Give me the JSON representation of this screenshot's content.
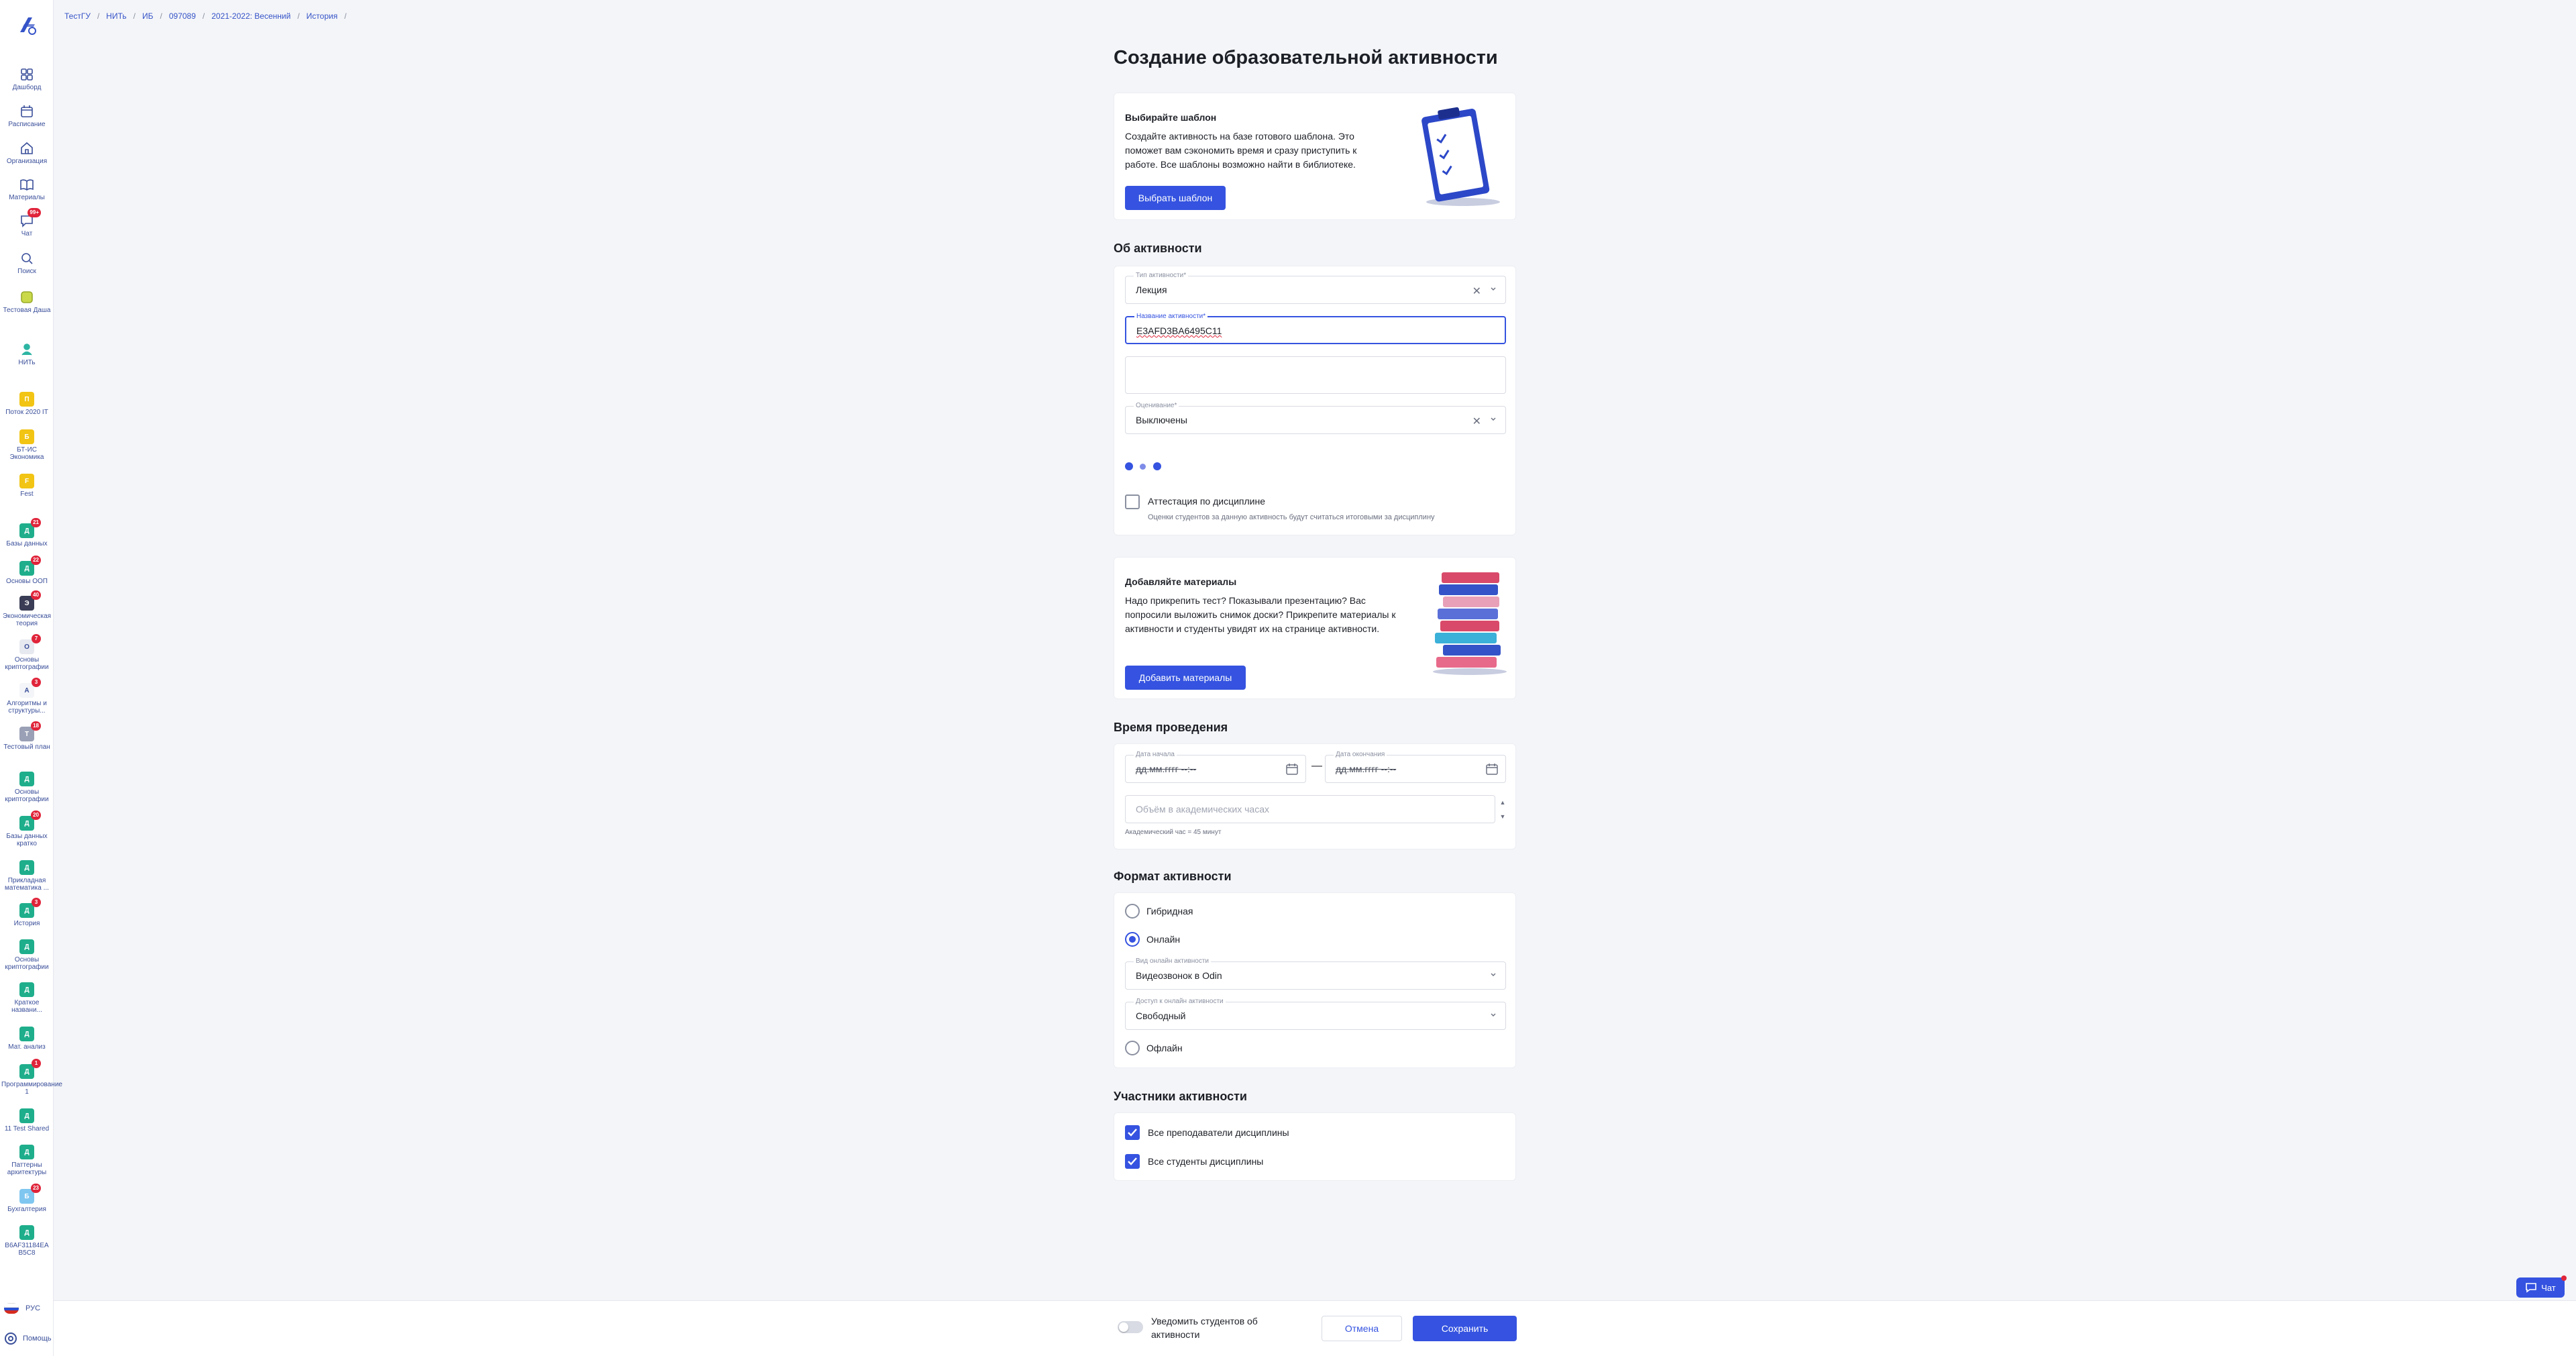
{
  "breadcrumb": [
    "ТестГУ",
    "НИТь",
    "ИБ",
    "097089",
    "2021-2022: Весенний",
    "История"
  ],
  "sidebar": {
    "nav": [
      {
        "label": "Дашборд",
        "icon": "dashboard-icon"
      },
      {
        "label": "Расписание",
        "icon": "calendar-icon"
      },
      {
        "label": "Организация",
        "icon": "home-icon"
      },
      {
        "label": "Материалы",
        "icon": "book-icon"
      },
      {
        "label": "Чат",
        "icon": "chat-icon",
        "badge": "99+"
      },
      {
        "label": "Поиск",
        "icon": "search-icon"
      },
      {
        "label": "Тестовая Даша",
        "icon": "test-icon"
      },
      {
        "label": "НИТь",
        "icon": "nit-icon"
      }
    ],
    "groups": [
      {
        "letter": "П",
        "label": "Поток 2020 IT",
        "color": "#f2c414"
      },
      {
        "letter": "Б",
        "label": "БТ-ИС Экономика",
        "color": "#f2c414"
      },
      {
        "letter": "F",
        "label": "Fest",
        "color": "#f2c414"
      }
    ],
    "courses": [
      {
        "letter": "Д",
        "label": "Базы данных",
        "color": "#1fae8c",
        "badge": "21"
      },
      {
        "letter": "Д",
        "label": "Основы ООП",
        "color": "#1fae8c",
        "badge": "22"
      },
      {
        "letter": "Э",
        "label": "Экономическая теория",
        "color": "#3a3d55",
        "badge": "40"
      },
      {
        "letter": "О",
        "label": "Основы криптографии",
        "color": "#e7e9f0",
        "badge": "7"
      },
      {
        "letter": "А",
        "label": "Алгоритмы и структуры...",
        "color": "#f4f5f8",
        "badge": "3"
      },
      {
        "letter": "Т",
        "label": "Тестовый план",
        "color": "#9aa0b5",
        "badge": "18"
      },
      {
        "letter": "Д",
        "label": "Основы криптографии",
        "color": "#1fae8c",
        "badge": ""
      },
      {
        "letter": "Д",
        "label": "Базы данных кратко",
        "color": "#1fae8c",
        "badge": "20"
      },
      {
        "letter": "Д",
        "label": "Прикладная математика ...",
        "color": "#1fae8c",
        "badge": ""
      },
      {
        "letter": "Д",
        "label": "История",
        "color": "#1fae8c",
        "badge": "3"
      },
      {
        "letter": "Д",
        "label": "Основы криптографии",
        "color": "#1fae8c",
        "badge": ""
      },
      {
        "letter": "Д",
        "label": "Краткое названи...",
        "color": "#1fae8c",
        "badge": ""
      },
      {
        "letter": "Д",
        "label": "Мат. анализ",
        "color": "#1fae8c",
        "badge": ""
      },
      {
        "letter": "Д",
        "label": "Программирование 1",
        "color": "#1fae8c",
        "badge": "1"
      },
      {
        "letter": "Д",
        "label": "11 Test Shared",
        "color": "#1fae8c",
        "badge": ""
      },
      {
        "letter": "Д",
        "label": "Паттерны архитектуры",
        "color": "#1fae8c",
        "badge": ""
      },
      {
        "letter": "Б",
        "label": "Бухгалтерия",
        "color": "#7fc6f0",
        "badge": "23"
      },
      {
        "letter": "Д",
        "label": "B6AF31184EA B5C8",
        "color": "#1fae8c",
        "badge": ""
      }
    ],
    "lang": "РУС",
    "help": "Помощь"
  },
  "page": {
    "title": "Создание образовательной активности"
  },
  "template_card": {
    "heading": "Выбирайте шаблон",
    "text": "Создайте активность на базе готового шаблона. Это поможет вам сэкономить время и сразу приступить к работе. Все шаблоны возможно найти в библиотеке.",
    "button": "Выбрать шаблон"
  },
  "about": {
    "section": "Об активности",
    "type_label": "Тип активности*",
    "type_value": "Лекция",
    "name_label": "Название активности*",
    "name_value": "E3AFD3BA6495C11",
    "grading_label": "Оценивание*",
    "grading_value": "Выключены",
    "attestation_label": "Аттестация по дисциплине",
    "attestation_hint": "Оценки студентов за данную активность будут считаться итоговыми за дисциплину"
  },
  "materials_card": {
    "heading": "Добавляйте материалы",
    "text": "Надо прикрепить тест? Показывали презентацию? Вас попросили выложить снимок доски? Прикрепите материалы к активности и студенты увидят их на странице активности.",
    "button": "Добавить материалы"
  },
  "time": {
    "section": "Время проведения",
    "start_label": "Дата начала",
    "start_value": "дд.мм.гггг --:--",
    "end_label": "Дата окончания",
    "end_value": "дд.мм.гггг --:--",
    "dash": "—",
    "hours_placeholder": "Объём в академических часах",
    "hours_hint": "Академический час = 45 минут"
  },
  "format": {
    "section": "Формат активности",
    "hybrid": "Гибридная",
    "online": "Онлайн",
    "online_type_label": "Вид онлайн активности",
    "online_type_value": "Видеозвонок в Odin",
    "access_label": "Доступ к онлайн активности",
    "access_value": "Свободный",
    "offline": "Офлайн"
  },
  "participants": {
    "section": "Участники активности",
    "teachers": "Все преподаватели дисциплины",
    "students": "Все студенты дисциплины"
  },
  "footer": {
    "notify": "Уведомить студентов об активности",
    "cancel": "Отмена",
    "save": "Сохранить"
  },
  "chat_button": "Чат",
  "colors": {
    "accent": "#3553e0",
    "badge": "#e0243a",
    "course": "#1fae8c"
  }
}
